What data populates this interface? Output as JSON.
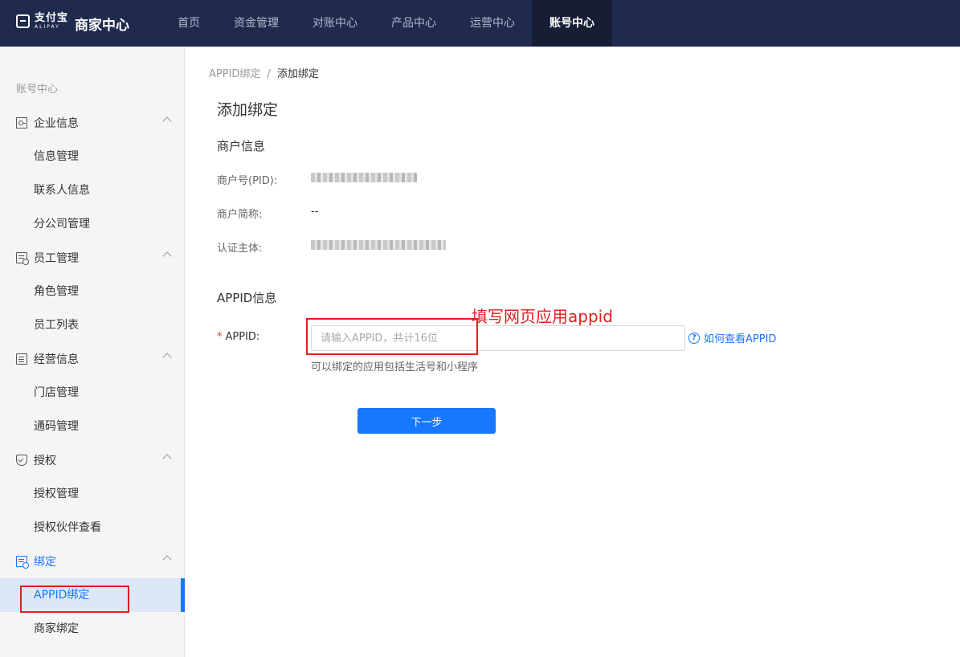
{
  "header": {
    "logo_cn": "支付宝",
    "logo_en": "ALIPAY",
    "app_title": "商家中心",
    "nav": [
      {
        "label": "首页"
      },
      {
        "label": "资金管理"
      },
      {
        "label": "对账中心"
      },
      {
        "label": "产品中心"
      },
      {
        "label": "运营中心"
      },
      {
        "label": "账号中心",
        "active": true
      }
    ]
  },
  "sidebar": {
    "title": "账号中心",
    "groups": [
      {
        "label": "企业信息",
        "icon": "id-card-icon",
        "items": [
          "信息管理",
          "联系人信息",
          "分公司管理"
        ]
      },
      {
        "label": "员工管理",
        "icon": "employee-doc-icon",
        "items": [
          "角色管理",
          "员工列表"
        ]
      },
      {
        "label": "经营信息",
        "icon": "list-icon",
        "items": [
          "门店管理",
          "通码管理"
        ]
      },
      {
        "label": "授权",
        "icon": "shield-check-icon",
        "items": [
          "授权管理",
          "授权伙伴查看"
        ]
      },
      {
        "label": "绑定",
        "icon": "bind-doc-icon",
        "items": [
          "APPID绑定",
          "商家绑定"
        ],
        "active_item": "APPID绑定"
      }
    ]
  },
  "main": {
    "breadcrumb": {
      "parent": "APPID绑定",
      "separator": "/",
      "current": "添加绑定"
    },
    "page_title": "添加绑定",
    "merchant_section": {
      "title": "商户信息",
      "fields": [
        {
          "label": "商户号(PID):",
          "value": "",
          "obscured": true
        },
        {
          "label": "商户简称:",
          "value": "--"
        },
        {
          "label": "认证主体:",
          "value": "",
          "obscured": true
        }
      ]
    },
    "appid_section": {
      "title": "APPID信息",
      "required_mark": "*",
      "label": "APPID:",
      "input_value": "",
      "input_placeholder": "请输入APPID，共计16位",
      "help_link": "如何查看APPID",
      "help_icon": "?",
      "hint": "可以绑定的应用包括生活号和小程序"
    },
    "annotation": "填写网页应用appid",
    "next_button": "下一步"
  },
  "colors": {
    "header_bg": "#1f2a4d",
    "primary": "#1677ff",
    "annotation_red": "#e02020"
  }
}
